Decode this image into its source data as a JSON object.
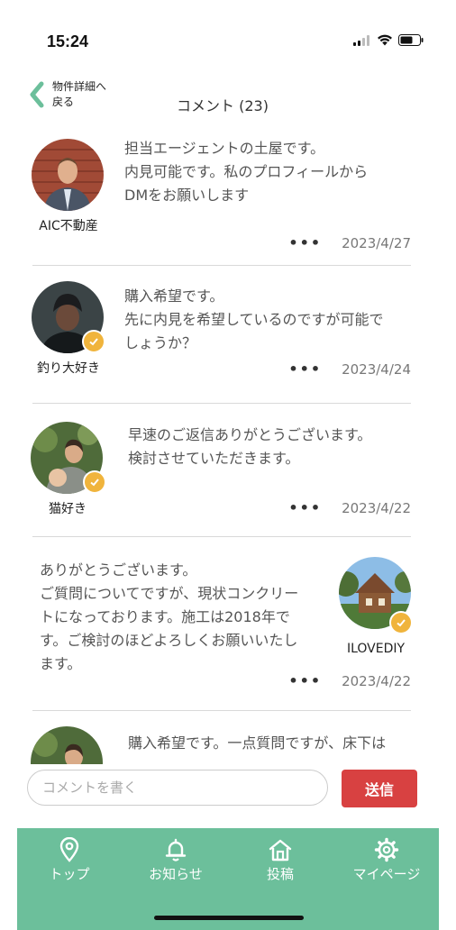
{
  "status": {
    "time": "15:24"
  },
  "nav": {
    "back_label": "物件詳細へ戻る",
    "title": "コメント (23)"
  },
  "colors": {
    "accent": "#6cbf9b",
    "send": "#d84141",
    "badge": "#f0b43c"
  },
  "comments": [
    {
      "author": "AIC不動産",
      "text": "担当エージェントの土屋です。\n内見可能です。私のプロフィールから\nDMをお願いします",
      "date": "2023/4/27",
      "more": "•••",
      "verified": false
    },
    {
      "author": "釣り大好き",
      "text": "購入希望です。\n先に内見を希望しているのですが可能で\nしょうか？",
      "date": "2023/4/24",
      "more": "•••",
      "verified": true
    },
    {
      "author": "猫好き",
      "text": "早速のご返信ありがとうございます。\n検討させていただきます。",
      "date": "2023/4/22",
      "more": "•••",
      "verified": true
    },
    {
      "author": "ILOVEDIY",
      "text": "ありがとうございます。\nご質問についてですが、現状コンクリー\nトになっております。施工は2018年で\nす。ご検討のほどよろしくお願いいたし\nます。",
      "date": "2023/4/22",
      "more": "•••",
      "verified": true
    },
    {
      "author": "",
      "text": "購入希望です。一点質問ですが、床下は",
      "date": "",
      "more": "",
      "verified": true
    }
  ],
  "compose": {
    "placeholder": "コメントを書く",
    "send_label": "送信"
  },
  "tabs": [
    {
      "label": "トップ",
      "icon": "map-pin-icon"
    },
    {
      "label": "お知らせ",
      "icon": "bell-icon"
    },
    {
      "label": "投稿",
      "icon": "house-icon"
    },
    {
      "label": "マイページ",
      "icon": "gear-icon"
    }
  ]
}
